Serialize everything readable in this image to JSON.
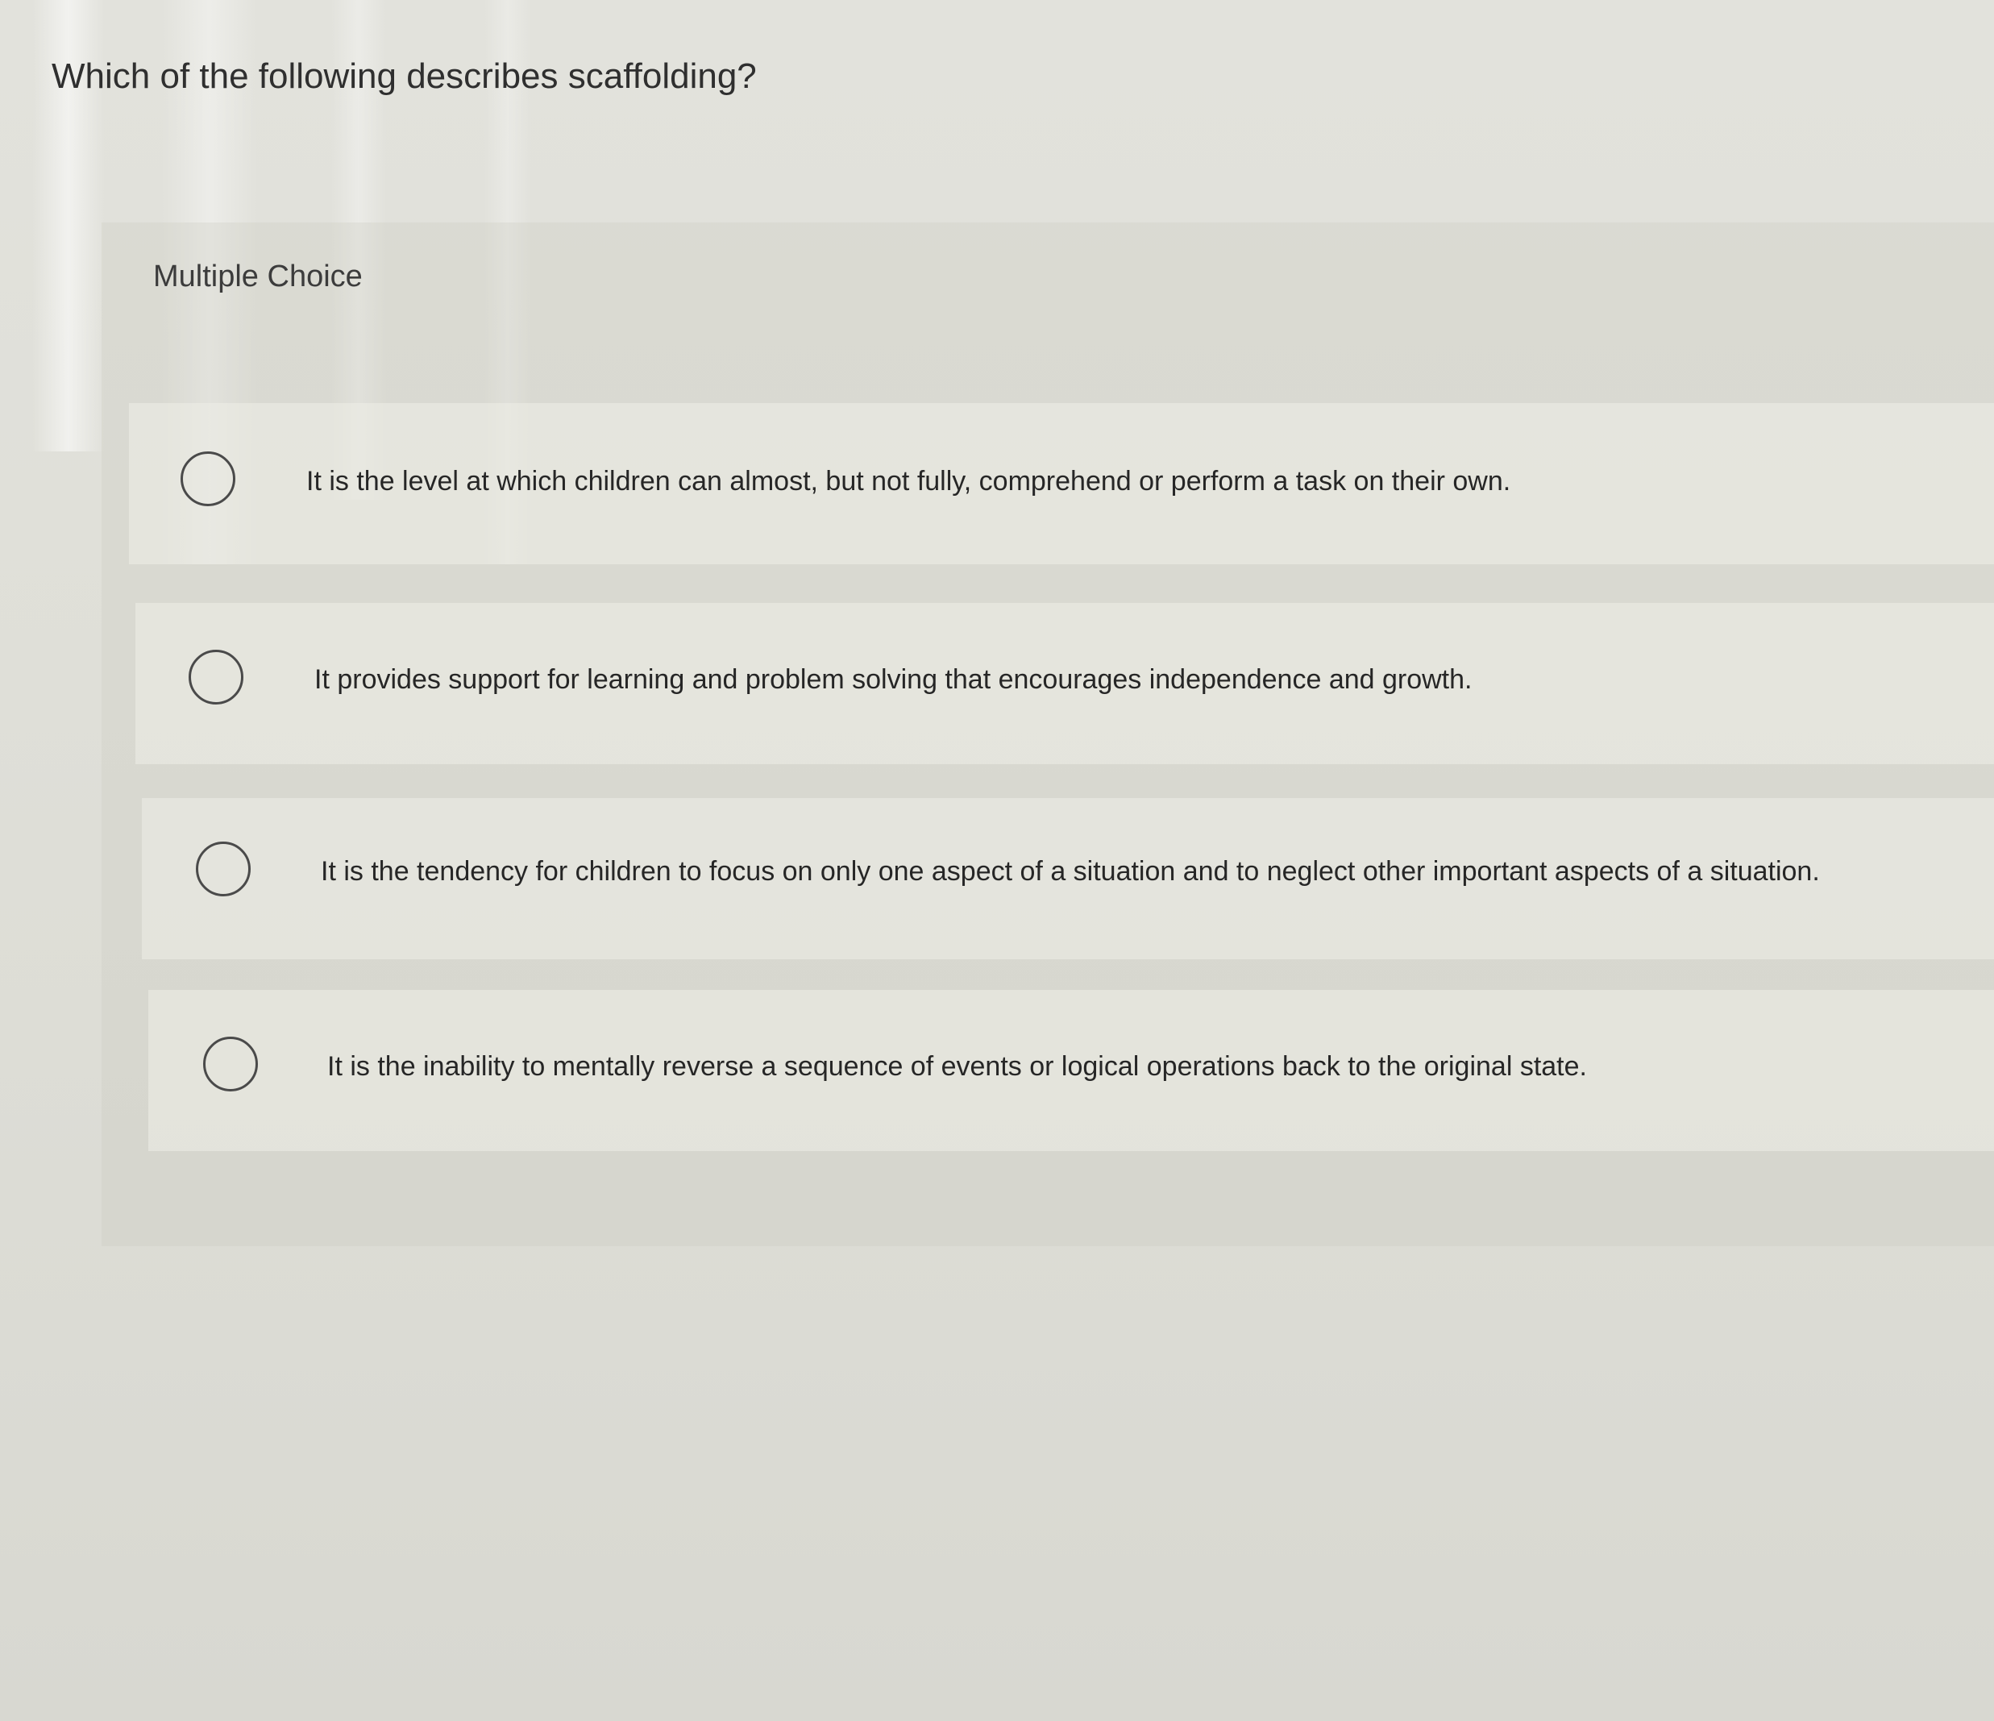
{
  "question": {
    "text": "Which of the following describes scaffolding?"
  },
  "section": {
    "label": "Multiple Choice"
  },
  "options": [
    {
      "text": "It is the level at which children can almost, but not fully, comprehend or perform a task on their own.",
      "selected": false
    },
    {
      "text": "It provides support for learning and problem solving that encourages independence and growth.",
      "selected": false
    },
    {
      "text": "It is the tendency for children to focus on only one aspect of a situation and to neglect other important aspects of a situation.",
      "selected": false
    },
    {
      "text": "It is the inability to mentally reverse a sequence of events or logical operations back to the original state.",
      "selected": false
    }
  ]
}
